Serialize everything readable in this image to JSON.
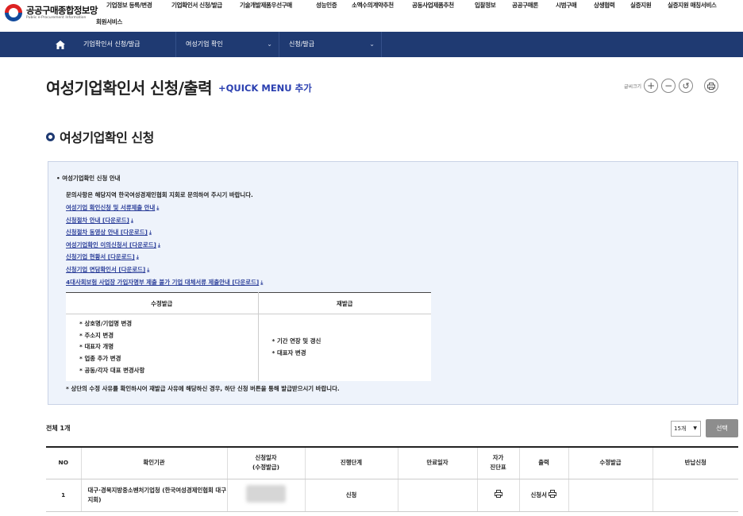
{
  "header": {
    "logo_title": "공공구매종합정보망",
    "logo_subtitle": "Public e-Procurement Information",
    "gnb": [
      "기업정보 등록/변경",
      "기업확인서 신청/발급",
      "기술개발제품우선구매",
      "성능인증",
      "소액수의계약추천",
      "공동사업제품추천",
      "입찰정보",
      "공공구매론",
      "시범구매",
      "상생협력",
      "실증지원",
      "실증지원 매칭서비스",
      "회원서비스"
    ]
  },
  "navbar": {
    "home_icon": "home-icon",
    "items": [
      "기업확인서 신청/발급",
      "여성기업 확인",
      "신청/발급"
    ]
  },
  "page": {
    "title": "여성기업확인서 신청/출력",
    "quick_menu": "+QUICK MENU 추가",
    "font_size_label": "글씨크기",
    "section_title": "여성기업확인 신청"
  },
  "info": {
    "heading": "• 여성기업확인 신청 안내",
    "description": "문의사항은 해당지역 한국여성경제인협회 지회로 문의하여 주시기 바랍니다.",
    "links": [
      "여성기업 확인신청 및 서류제출 안내",
      "신청절차 안내 [다운로드]",
      "신청절차 동영상 안내 [다운로드]",
      "여성기업확인 이의신청서 [다운로드]",
      "신청기업 현황서 [다운로드]",
      "신청기업 면담확인서 [다운로드]",
      "4대사회보험 사업장 가입자명부 제출 불가 기업 대체서류 제출안내 [다운로드]"
    ],
    "table": {
      "headers": [
        "수정발급",
        "재발급"
      ],
      "col1": [
        "* 상호명/기업명 변경",
        "* 주소지 변경",
        "* 대표자 개명",
        "* 업종 추가 변경",
        "* 공동/각자 대표 변경사항"
      ],
      "col2": [
        "* 기간 연장 및 갱신",
        "* 대표자 변경"
      ]
    },
    "note": "* 상단의 수정 사유를 확인하시어 재발급 사유에 해당하신 경우, 하단 신청 버튼을 통해 발급받으시기 바랍니다."
  },
  "list": {
    "total": "전체 1개",
    "page_size": "15개",
    "select_button": "선택",
    "headers": [
      "NO",
      "확인기관",
      "신청일자\n(수정발급)",
      "진행단계",
      "만료일자",
      "자가\n진단표",
      "출력",
      "수정발급",
      "반납신청"
    ],
    "rows": [
      {
        "no": "1",
        "agency": "대구·경북지방중소벤처기업청 (한국여성경제인협회 대구지회)",
        "status": "신청",
        "print_label": "신청서"
      }
    ]
  }
}
